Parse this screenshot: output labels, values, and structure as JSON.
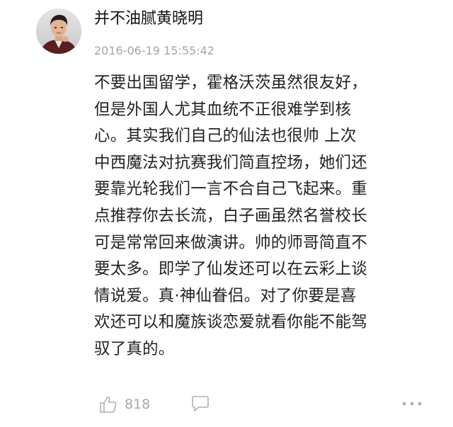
{
  "post": {
    "author": "并不油腻黄晓明",
    "timestamp": "2016-06-19 15:55:42",
    "content_lines": [
      "不要出国留学，霍格沃茨虽然很友好，",
      "但是外国人尤其血统不正很难学到核",
      "心。其实我们自己的仙法也很帅 上次",
      "中西魔法对抗赛我们简直控场，她们还",
      "要靠光轮我们一言不合自己飞起来。重",
      "点推荐你去长流，白子画虽然名誉校长",
      "可是常常回来做演讲。帅的师哥简直不",
      "要太多。即学了仙发还可以在云彩上谈",
      "情说爱。真·神仙眷侣。对了你要是喜",
      "欢还可以和魔族谈恋爱就看你能不能驾",
      "驭了真的。"
    ]
  },
  "actions": {
    "like_count": "818",
    "like_icon": "thumbs-up-icon",
    "comment_icon": "comment-bubble-icon",
    "more_icon": "more-dots-icon"
  },
  "colors": {
    "text": "#222222",
    "muted": "#a6a6a6",
    "background": "#ffffff"
  }
}
